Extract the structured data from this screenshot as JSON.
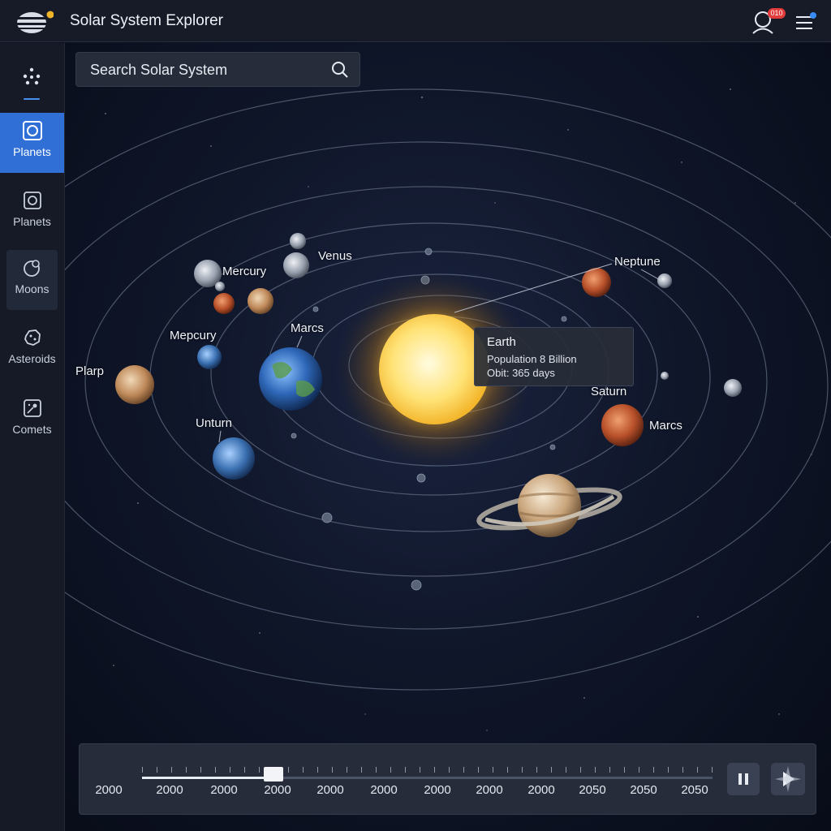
{
  "app": {
    "title": "Solar System Explorer",
    "notification_count": "010"
  },
  "search": {
    "placeholder": "Search Solar System"
  },
  "sidebar": {
    "items": [
      {
        "label": "Planets",
        "icon": "planet-frame-icon",
        "state": "active"
      },
      {
        "label": "Planets",
        "icon": "planet-frame-icon",
        "state": "default"
      },
      {
        "label": "Moons",
        "icon": "moon-icon",
        "state": "hover"
      },
      {
        "label": "Asteroids",
        "icon": "asteroid-icon",
        "state": "default"
      },
      {
        "label": "Comets",
        "icon": "comet-icon",
        "state": "default"
      }
    ]
  },
  "map": {
    "labels": {
      "mercury": "Mercury",
      "venus": "Venus",
      "neptune": "Neptune",
      "mepcury": "Mepcury",
      "marcs_top": "Marcs",
      "plarp": "Plarp",
      "unturn": "Unturn",
      "saturn": "Saturn",
      "marcs_right": "Marcs"
    },
    "info_card": {
      "title": "Earth",
      "population": "Population 8 Billion",
      "orbit": "Obit: 365 days"
    }
  },
  "timeline": {
    "years": [
      "2000",
      "2000",
      "2000",
      "2000",
      "2000",
      "2000",
      "2000",
      "2000",
      "2000",
      "2050",
      "2050",
      "2050"
    ],
    "progress": 0.23
  },
  "colors": {
    "accent": "#2f6fd6",
    "sun": "#ffd85a",
    "badge": "#e23b3b"
  }
}
